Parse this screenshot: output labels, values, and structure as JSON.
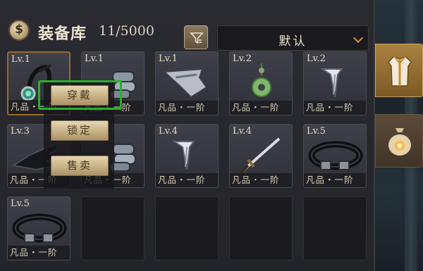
{
  "header": {
    "title": "装备库",
    "count": "11/5000",
    "sort_value": "默认",
    "icons": {
      "bag": "money-bag-icon",
      "filter": "filter-icon",
      "dropdown": "chevron-down-icon"
    }
  },
  "items": [
    {
      "level": "Lv.1",
      "grade": "凡品・一阶",
      "art": "amulet",
      "selected": true
    },
    {
      "level": "Lv.1",
      "grade": "凡品・一阶",
      "art": "bracer"
    },
    {
      "level": "Lv.1",
      "grade": "凡品・一阶",
      "art": "shoulder"
    },
    {
      "level": "Lv.2",
      "grade": "凡品・一阶",
      "art": "jade-ring"
    },
    {
      "level": "Lv.2",
      "grade": "凡品・一阶",
      "art": "dagger-blade"
    },
    {
      "level": "Lv.3",
      "grade": "凡品・一阶",
      "art": "glove"
    },
    {
      "level": "",
      "grade": "凡品・一阶",
      "art": "bracer"
    },
    {
      "level": "Lv.4",
      "grade": "凡品・一阶",
      "art": "dagger-blade"
    },
    {
      "level": "Lv.4",
      "grade": "凡品・一阶",
      "art": "sword"
    },
    {
      "level": "Lv.5",
      "grade": "凡品・一阶",
      "art": "belt"
    },
    {
      "level": "Lv.5",
      "grade": "凡品・一阶",
      "art": "belt"
    }
  ],
  "empty_slots": 4,
  "context_menu": {
    "equip": "穿戴",
    "lock": "锁定",
    "sell": "售卖"
  },
  "tabs": [
    {
      "icon": "robe-icon",
      "active": true
    },
    {
      "icon": "treasure-bag-icon",
      "active": false
    }
  ],
  "colors": {
    "highlight": "#29b12a",
    "accent": "#e58a2c",
    "tab_active": "#a9823f"
  }
}
